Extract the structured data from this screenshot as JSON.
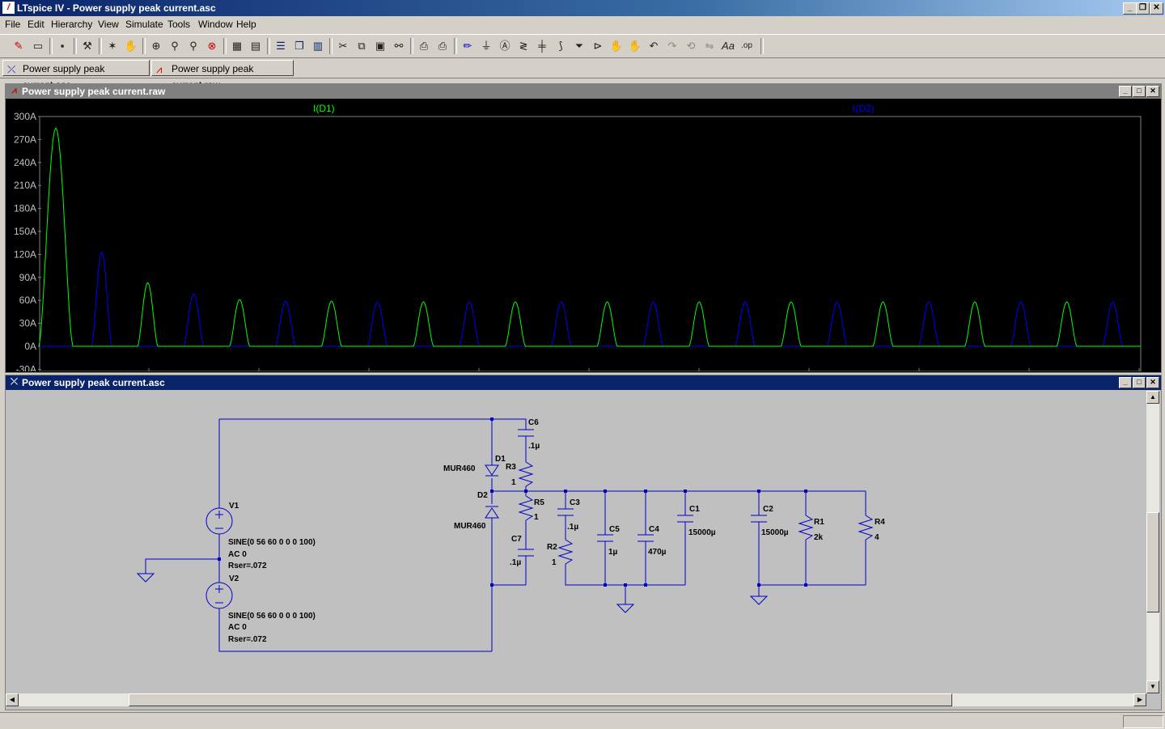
{
  "window": {
    "title": "LTspice IV - Power supply peak current.asc",
    "min": "_",
    "max": "❐",
    "close": "✕"
  },
  "menu": [
    "File",
    "Edit",
    "Hierarchy",
    "View",
    "Simulate",
    "Tools",
    "Window",
    "Help"
  ],
  "tabs": [
    {
      "label": "Power supply peak current.asc",
      "icon": "schematic-icon"
    },
    {
      "label": "Power supply peak current.raw",
      "icon": "waveform-icon"
    }
  ],
  "waveform": {
    "title": "Power supply peak current.raw",
    "background": "#000000",
    "traces": [
      {
        "name": "I(D1)",
        "color": "#00ff00"
      },
      {
        "name": "I(D2)",
        "color": "#0000ff"
      }
    ],
    "y_ticks": [
      "300A",
      "270A",
      "240A",
      "210A",
      "180A",
      "150A",
      "120A",
      "90A",
      "60A",
      "30A",
      "0A",
      "-30A"
    ]
  },
  "chart_data": {
    "type": "line",
    "title": "",
    "xlabel": "",
    "ylabel": "",
    "ylim": [
      -30,
      300
    ],
    "series": [
      {
        "name": "I(D1)",
        "color": "#00ff00",
        "pulses": [
          {
            "peak": 285
          },
          {
            "peak": 83
          },
          {
            "peak": 61
          },
          {
            "peak": 59
          },
          {
            "peak": 58
          },
          {
            "peak": 58
          },
          {
            "peak": 58
          },
          {
            "peak": 58
          },
          {
            "peak": 58
          },
          {
            "peak": 58
          },
          {
            "peak": 58
          },
          {
            "peak": 58
          }
        ]
      },
      {
        "name": "I(D2)",
        "color": "#0000ff",
        "pulses": [
          {
            "peak": 123
          },
          {
            "peak": 68
          },
          {
            "peak": 59
          },
          {
            "peak": 58
          },
          {
            "peak": 58
          },
          {
            "peak": 58
          },
          {
            "peak": 58
          },
          {
            "peak": 58
          },
          {
            "peak": 58
          },
          {
            "peak": 58
          },
          {
            "peak": 58
          },
          {
            "peak": 58
          }
        ]
      }
    ]
  },
  "schematic": {
    "title": "Power supply peak current.asc",
    "wire_color": "#0000c8",
    "labels": {
      "V1": "V1",
      "V2": "V2",
      "V1_spec": "SINE(0 56 60 0 0 0 100)",
      "V1_ac": "AC 0",
      "V1_rser": "Rser=.072",
      "V2_spec": "SINE(0 56 60 0 0 0 100)",
      "V2_ac": "AC 0",
      "V2_rser": "Rser=.072",
      "D1": "D1",
      "D1_model": "MUR460",
      "D2": "D2",
      "D2_model": "MUR460",
      "C6": "C6",
      "C6_val": ".1µ",
      "R3": "R3",
      "R3_val": "1",
      "R5": "R5",
      "R5_val": "1",
      "C7": "C7",
      "C7_val": ".1µ",
      "C3": "C3",
      "C3_val": ".1µ",
      "R2": "R2",
      "R2_val": "1",
      "C5": "C5",
      "C5_val": "1µ",
      "C4": "C4",
      "C4_val": "470µ",
      "C1": "C1",
      "C1_val": "15000µ",
      "C2": "C2",
      "C2_val": "15000µ",
      "R1": "R1",
      "R1_val": "2k",
      "R4": "R4",
      "R4_val": "4"
    }
  }
}
